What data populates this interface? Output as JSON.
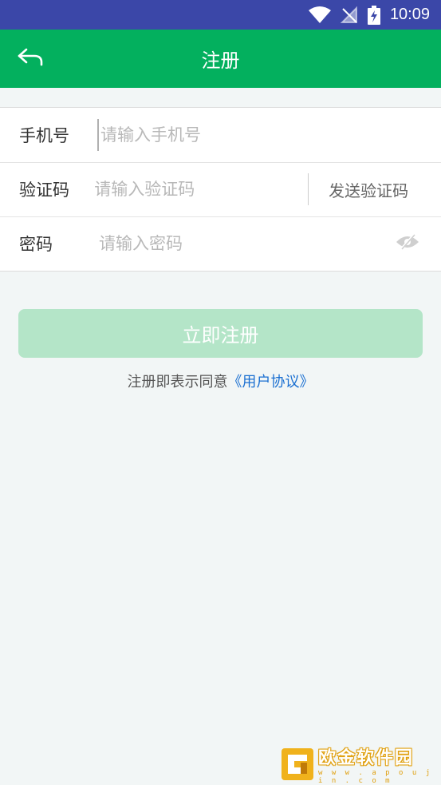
{
  "status_bar": {
    "time": "10:09"
  },
  "app_bar": {
    "title": "注册"
  },
  "form": {
    "phone": {
      "label": "手机号",
      "placeholder": "请输入手机号",
      "value": ""
    },
    "code": {
      "label": "验证码",
      "placeholder": "请输入验证码",
      "value": "",
      "send_label": "发送验证码"
    },
    "password": {
      "label": "密码",
      "placeholder": "请输入密码",
      "value": ""
    }
  },
  "register_button": {
    "label": "立即注册"
  },
  "agreement": {
    "prefix": "注册即表示同意",
    "link": "《用户协议》"
  },
  "watermark": {
    "name": "欧金软件园",
    "url": "w w w . a p o u j i n . c o m"
  },
  "colors": {
    "status_bar": "#3b47a8",
    "app_bar": "#03b05e",
    "button_disabled": "#b4e5c8",
    "link": "#1a6fd1",
    "watermark_accent": "#e0a010"
  },
  "icons": {
    "back": "back-arrow-icon",
    "wifi": "wifi-icon",
    "signal": "no-signal-icon",
    "battery": "battery-charging-icon",
    "eye": "eye-off-icon"
  }
}
